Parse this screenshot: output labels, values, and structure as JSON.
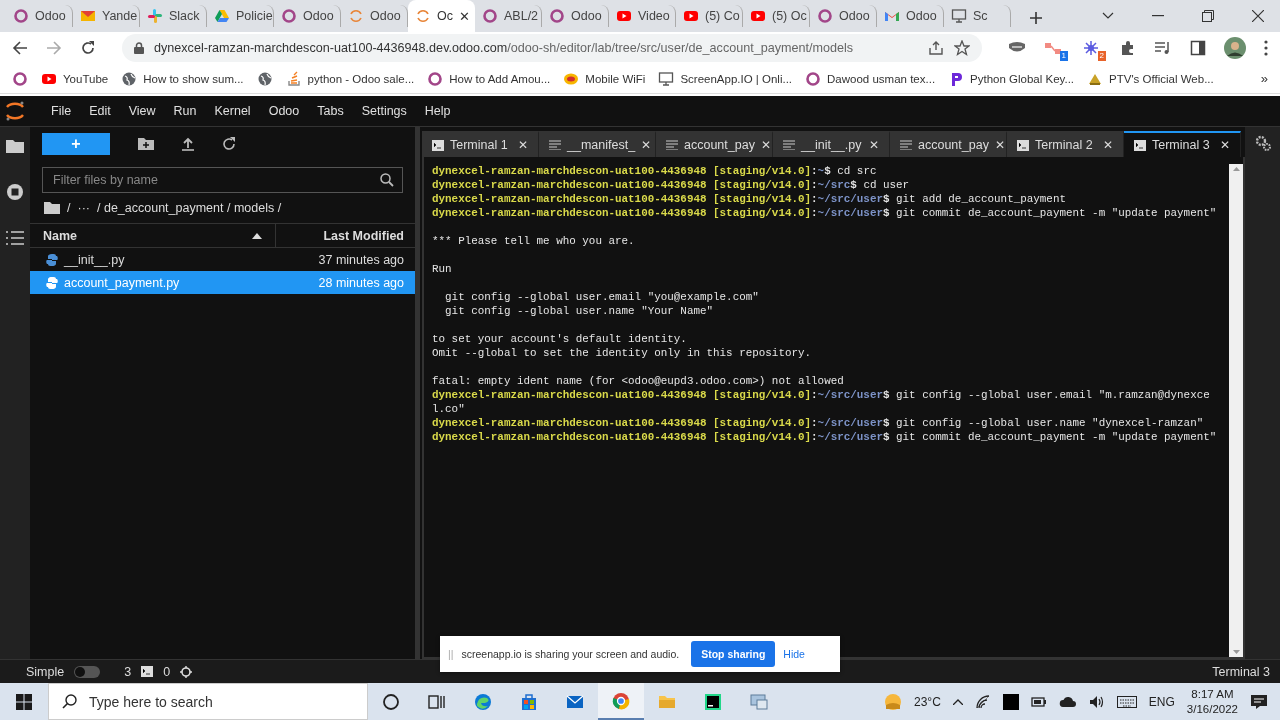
{
  "browser": {
    "tabs": [
      {
        "label": "Odoo",
        "kind": "odoo",
        "selected": false
      },
      {
        "label": "Yande",
        "kind": "mail",
        "selected": false
      },
      {
        "label": "Slack",
        "kind": "slack",
        "selected": false
      },
      {
        "label": "Policie",
        "kind": "drive",
        "selected": false
      },
      {
        "label": "Odoo",
        "kind": "odoo",
        "selected": false
      },
      {
        "label": "Odoo",
        "kind": "loading",
        "selected": false
      },
      {
        "label": "Oc",
        "kind": "loading",
        "selected": true,
        "close": "✕"
      },
      {
        "label": "ABL/2",
        "kind": "odoo",
        "selected": false
      },
      {
        "label": "Odoo",
        "kind": "odoo",
        "selected": false
      },
      {
        "label": "Video",
        "kind": "youtube",
        "selected": false
      },
      {
        "label": "(5) Co",
        "kind": "youtube",
        "selected": false
      },
      {
        "label": "(5) Oc",
        "kind": "youtube",
        "selected": false
      },
      {
        "label": "Odoo",
        "kind": "odoo",
        "selected": false
      },
      {
        "label": "Odoo",
        "kind": "gmail",
        "selected": false
      },
      {
        "label": "Sc",
        "kind": "screen",
        "selected": false
      }
    ],
    "url": {
      "host": "dynexcel-ramzan-marchdescon-uat100-4436948.dev.odoo.com",
      "path": "/odoo-sh/editor/lab/tree/src/user/de_account_payment/models"
    },
    "extension_badges": [
      "1",
      "2"
    ],
    "bookmarks": [
      {
        "kind": "odoo"
      },
      {
        "label": "YouTube",
        "kind": "youtube"
      },
      {
        "label": "How to show sum...",
        "kind": "globe"
      },
      {
        "kind": "globe"
      },
      {
        "label": "python - Odoo sale...",
        "kind": "stack"
      },
      {
        "label": "How to Add Amou...",
        "kind": "odoo"
      },
      {
        "label": "Mobile WiFi",
        "kind": "jazz"
      },
      {
        "label": "ScreenApp.IO | Onli...",
        "kind": "screen"
      },
      {
        "label": "Dawood usman tex...",
        "kind": "odoo"
      },
      {
        "label": "Python Global Key...",
        "kind": "p"
      },
      {
        "label": "PTV's Official Web...",
        "kind": "ptv"
      }
    ],
    "bookmarks_more": "»"
  },
  "menu": [
    "File",
    "Edit",
    "View",
    "Run",
    "Kernel",
    "Odoo",
    "Tabs",
    "Settings",
    "Help"
  ],
  "file_browser": {
    "new_label": "+",
    "filter_placeholder": "Filter files by name",
    "breadcrumb": [
      "/",
      "···",
      "/ de_account_payment / models /"
    ],
    "columns": [
      "Name",
      "Last Modified"
    ],
    "files": [
      {
        "name": "__init__.py",
        "modified": "37 minutes ago",
        "selected": false
      },
      {
        "name": "account_payment.py",
        "modified": "28 minutes ago",
        "selected": true
      }
    ]
  },
  "editor_tabs": [
    {
      "label": "Terminal 1",
      "kind": "terminal",
      "selected": false,
      "close": "✕"
    },
    {
      "label": "__manifest_",
      "kind": "file",
      "selected": false,
      "close": "✕"
    },
    {
      "label": "account_pay",
      "kind": "file",
      "selected": false,
      "close": "✕"
    },
    {
      "label": "__init__.py",
      "kind": "file",
      "selected": false,
      "close": "✕"
    },
    {
      "label": "account_pay",
      "kind": "file",
      "selected": false,
      "close": "✕"
    },
    {
      "label": "Terminal 2",
      "kind": "terminal",
      "selected": false,
      "close": "✕"
    },
    {
      "label": "Terminal 3",
      "kind": "terminal",
      "selected": true,
      "close": "✕"
    }
  ],
  "terminal": [
    {
      "kind": "prompt",
      "host": "dynexcel-ramzan-marchdescon-uat100-4436948",
      "branch": " [staging/v14.0]",
      "sep": ":",
      "path": "~",
      "prompt_char": "$",
      "command": "cd src"
    },
    {
      "kind": "prompt",
      "host": "dynexcel-ramzan-marchdescon-uat100-4436948",
      "branch": " [staging/v14.0]",
      "sep": ":",
      "path": "~/src",
      "prompt_char": "$",
      "command": "cd user"
    },
    {
      "kind": "prompt",
      "host": "dynexcel-ramzan-marchdescon-uat100-4436948",
      "branch": " [staging/v14.0]",
      "sep": ":",
      "path": "~/src/user",
      "prompt_char": "$",
      "command": "git add de_account_payment"
    },
    {
      "kind": "prompt",
      "host": "dynexcel-ramzan-marchdescon-uat100-4436948",
      "branch": " [staging/v14.0]",
      "sep": ":",
      "path": "~/src/user",
      "prompt_char": "$",
      "command": "git commit de_account_payment -m \"update payment\""
    },
    {
      "kind": "blank"
    },
    {
      "kind": "output",
      "text": "*** Please tell me who you are."
    },
    {
      "kind": "blank"
    },
    {
      "kind": "output",
      "text": "Run"
    },
    {
      "kind": "blank"
    },
    {
      "kind": "output",
      "text": "  git config --global user.email \"you@example.com\""
    },
    {
      "kind": "output",
      "text": "  git config --global user.name \"Your Name\""
    },
    {
      "kind": "blank"
    },
    {
      "kind": "output",
      "text": "to set your account's default identity."
    },
    {
      "kind": "output",
      "text": "Omit --global to set the identity only in this repository."
    },
    {
      "kind": "blank"
    },
    {
      "kind": "output",
      "text": "fatal: empty ident name (for <odoo@eupd3.odoo.com>) not allowed"
    },
    {
      "kind": "prompt",
      "host": "dynexcel-ramzan-marchdescon-uat100-4436948",
      "branch": " [staging/v14.0]",
      "sep": ":",
      "path": "~/src/user",
      "prompt_char": "$",
      "command": "git config --global user.email \"m.ramzan@dynexcel.co\""
    },
    {
      "kind": "prompt",
      "host": "dynexcel-ramzan-marchdescon-uat100-4436948",
      "branch": " [staging/v14.0]",
      "sep": ":",
      "path": "~/src/user",
      "prompt_char": "$",
      "command": "git config --global user.name \"dynexcel-ramzan\""
    },
    {
      "kind": "prompt",
      "host": "dynexcel-ramzan-marchdescon-uat100-4436948",
      "branch": " [staging/v14.0]",
      "sep": ":",
      "path": "~/src/user",
      "prompt_char": "$",
      "command": "git commit de_account_payment -m \"update payment\""
    }
  ],
  "status_bar": {
    "mode_label": "Simple",
    "simple_mode": false,
    "terminals": "3",
    "kernels": "0",
    "current": "Terminal 3"
  },
  "share_bar": {
    "grip": "||",
    "text": "screenapp.io is sharing your screen and audio.",
    "stop": "Stop sharing",
    "hide": "Hide"
  },
  "taskbar": {
    "search_placeholder": "Type here to search",
    "apps": [
      {
        "kind": "cortana",
        "selected": false
      },
      {
        "kind": "taskview",
        "selected": false
      },
      {
        "kind": "edge",
        "selected": false
      },
      {
        "kind": "store",
        "selected": false
      },
      {
        "kind": "mail",
        "selected": false
      },
      {
        "kind": "chrome",
        "selected": true
      },
      {
        "kind": "files",
        "selected": false
      },
      {
        "kind": "pycharm",
        "selected": false
      },
      {
        "kind": "app",
        "selected": false
      }
    ],
    "temperature": "23°C",
    "language": "ENG",
    "time": "8:17 AM",
    "date": "3/16/2022"
  }
}
